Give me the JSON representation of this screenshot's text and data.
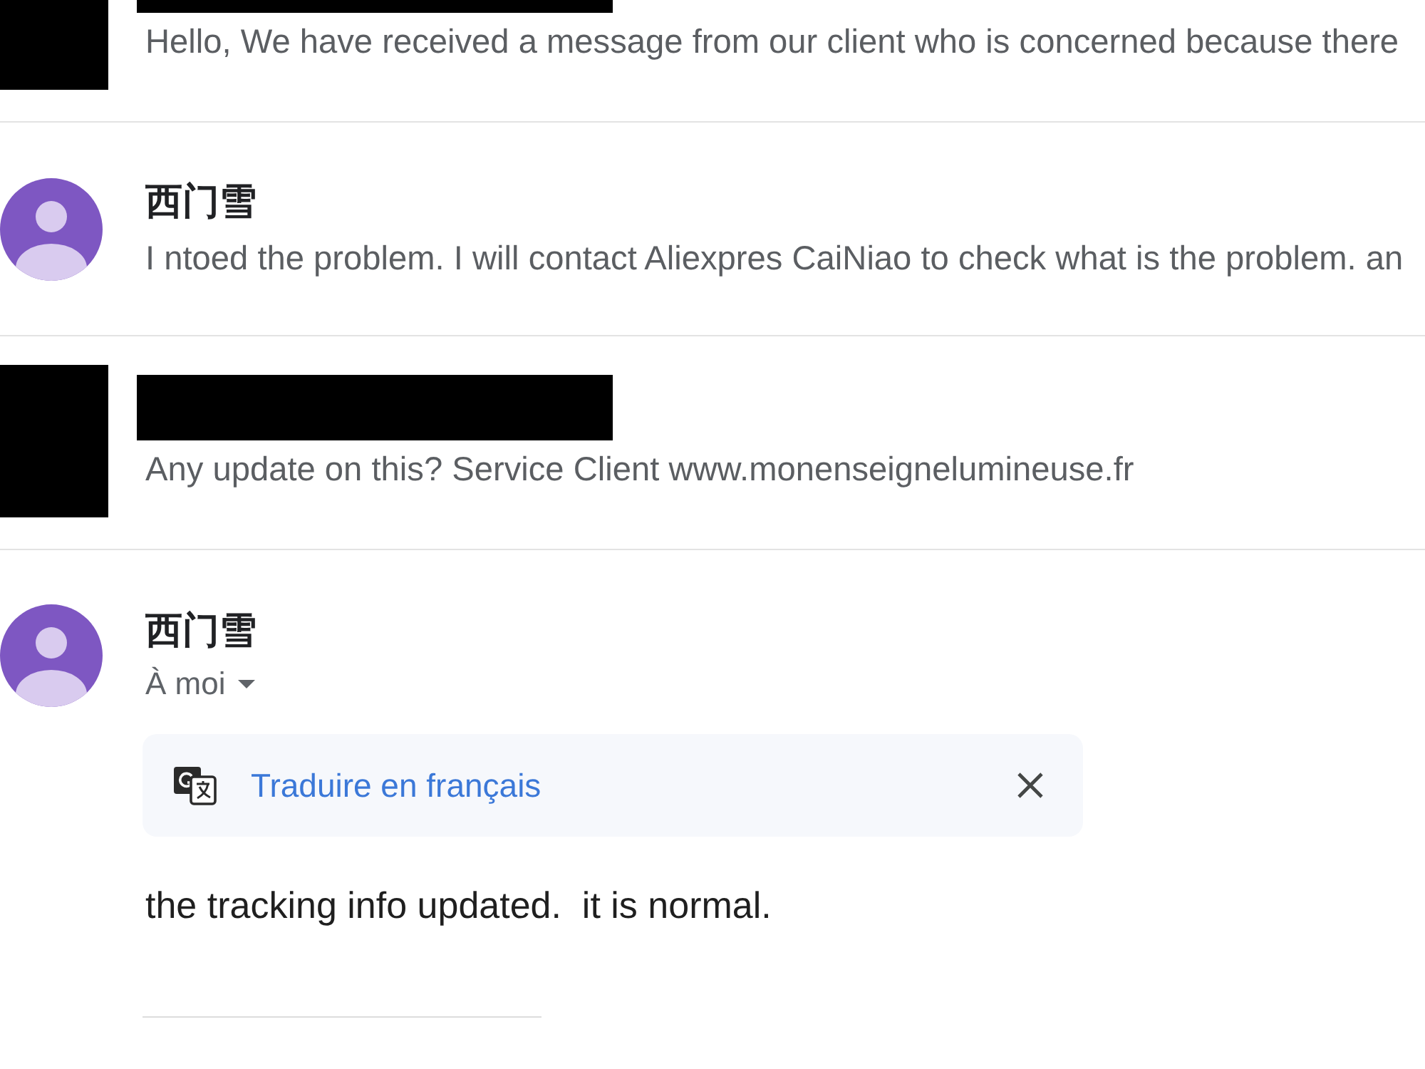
{
  "messages": [
    {
      "kind": "collapsed",
      "redacted": true,
      "snippet": "Hello, We have received a message from our client who is concerned because there"
    },
    {
      "kind": "collapsed",
      "redacted": false,
      "sender": "西门雪",
      "snippet": "I ntoed the problem. I will contact Aliexpres CaiNiao to check what is the problem. an"
    },
    {
      "kind": "collapsed",
      "redacted": true,
      "snippet": "Any update on this? Service Client www.monenseignelumineuse.fr"
    },
    {
      "kind": "expanded",
      "redacted": false,
      "sender": "西门雪",
      "recipient": "À moi",
      "translate_banner": {
        "link": "Traduire en français"
      },
      "body": "the tracking info updated.  it is normal."
    }
  ]
}
